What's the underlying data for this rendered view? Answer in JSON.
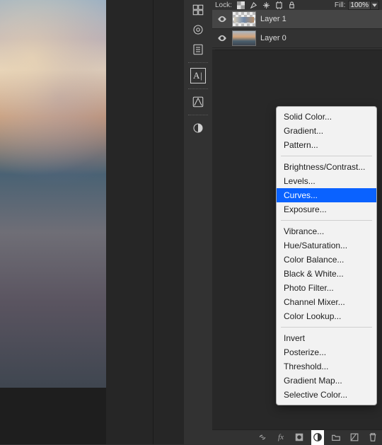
{
  "lock_row": {
    "label": "Lock:",
    "fill_label": "Fill:",
    "fill_value": "100%"
  },
  "layers": [
    {
      "name": "Layer 1"
    },
    {
      "name": "Layer 0"
    }
  ],
  "adjustment_menu": {
    "items": [
      "Solid Color...",
      "Gradient...",
      "Pattern...",
      "-",
      "Brightness/Contrast...",
      "Levels...",
      "Curves...",
      "Exposure...",
      "-",
      "Vibrance...",
      "Hue/Saturation...",
      "Color Balance...",
      "Black & White...",
      "Photo Filter...",
      "Channel Mixer...",
      "Color Lookup...",
      "-",
      "Invert",
      "Posterize...",
      "Threshold...",
      "Gradient Map...",
      "Selective Color..."
    ],
    "highlighted": "Curves..."
  }
}
